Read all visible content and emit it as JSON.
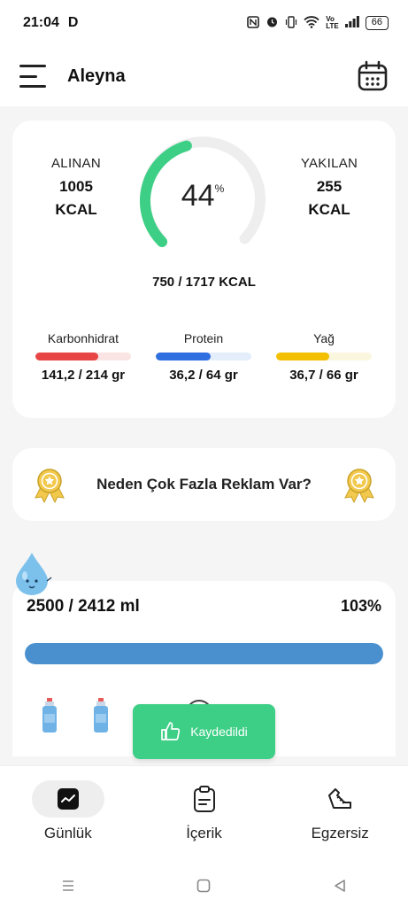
{
  "status": {
    "time": "21:04",
    "carrier_icon": "D",
    "battery": "66"
  },
  "header": {
    "title": "Aleyna"
  },
  "summary": {
    "taken_label": "ALINAN",
    "taken_value": "1005",
    "taken_unit": "KCAL",
    "burned_label": "YAKILAN",
    "burned_value": "255",
    "burned_unit": "KCAL",
    "percent": "44",
    "percent_sign": "%",
    "percent_fraction": 0.44,
    "total": "750 / 1717 KCAL",
    "macros": [
      {
        "label": "Karbonhidrat",
        "value": "141,2 / 214 gr",
        "fraction": 0.66,
        "color": "#e84545",
        "track": "#fbe4e4"
      },
      {
        "label": "Protein",
        "value": "36,2 / 64 gr",
        "fraction": 0.57,
        "color": "#2f6fe0",
        "track": "#e4eefb"
      },
      {
        "label": "Yağ",
        "value": "36,7 / 66 gr",
        "fraction": 0.56,
        "color": "#f2c000",
        "track": "#fbf6de"
      }
    ]
  },
  "ad": {
    "text": "Neden Çok Fazla Reklam Var?"
  },
  "water": {
    "amount": "2500 / 2412 ml",
    "percent": "103%",
    "fraction": 1.0
  },
  "toast": {
    "text": "Kaydedildi"
  },
  "tabs": [
    {
      "label": "Günlük",
      "active": true
    },
    {
      "label": "İçerik",
      "active": false
    },
    {
      "label": "Egzersiz",
      "active": false
    }
  ],
  "colors": {
    "ring": "#3ecf86",
    "ring_track": "#eeeeee",
    "water": "#4a8fce",
    "toast": "#3ecf86"
  }
}
